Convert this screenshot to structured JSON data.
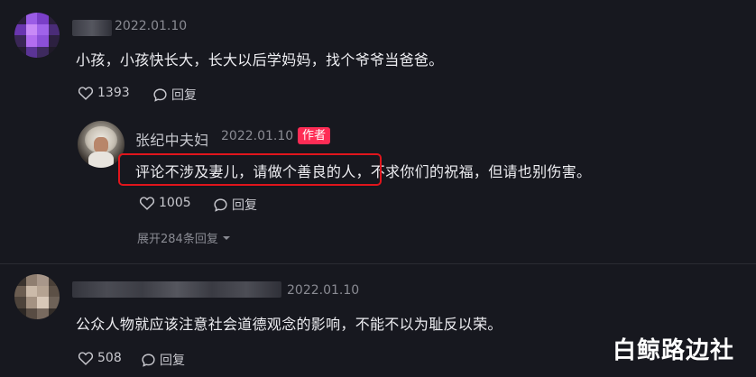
{
  "comments": [
    {
      "date": "2022.01.10",
      "text": "小孩，小孩快长大，长大以后学妈妈，找个爷爷当爸爸。",
      "likes": "1393",
      "reply_label": "回复",
      "avatar_colors": [
        "#8a3fd6",
        "#b06cf0",
        "#5a2a9a",
        "#c58af5"
      ]
    },
    {
      "date": "2022.01.10",
      "text": "公众人物就应该注意社会道德观念的影响，不能不以为耻反以荣。",
      "likes": "508",
      "reply_label": "回复",
      "avatar_colors": [
        "#8c7a6a",
        "#b7a493",
        "#6c5e52",
        "#d2c2b2"
      ]
    }
  ],
  "reply": {
    "username": "张纪中夫妇",
    "date": "2022.01.10",
    "badge": "作者",
    "text": "评论不涉及妻儿，请做个善良的人，不求你们的祝福，但请也别伤害。",
    "likes": "1005",
    "reply_label": "回复",
    "expand_label": "展开284条回复"
  },
  "watermark": "白鲸路边社",
  "colors": {
    "background": "#17181f",
    "accent_badge": "#fe2c55",
    "highlight_box": "#e0151c"
  }
}
